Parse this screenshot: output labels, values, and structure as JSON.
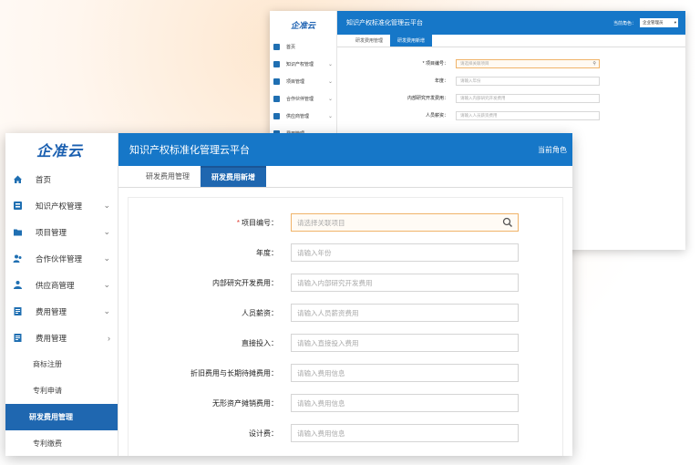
{
  "back_window": {
    "logo": "企准云",
    "title": "知识产权标准化管理云平台",
    "role_label": "当前角色：",
    "role_value": "企业管理员",
    "nav": [
      "首页",
      "知识产权管理",
      "项目管理",
      "合作伙伴管理",
      "供应商管理",
      "费用管理"
    ],
    "tabs": [
      "研发费用管理",
      "研发费用新增"
    ],
    "fields": [
      {
        "label": "* 项目编号：",
        "placeholder": "请选择关联项目"
      },
      {
        "label": "年度：",
        "placeholder": "请输入年份"
      },
      {
        "label": "内部研究开发费用：",
        "placeholder": "请输入内部研究开发费用"
      },
      {
        "label": "人员薪资：",
        "placeholder": "请输入人员薪资费用"
      }
    ]
  },
  "front_window": {
    "logo": "企准云",
    "title": "知识产权标准化管理云平台",
    "role_label": "当前角色",
    "sidebar": {
      "items": [
        {
          "label": "首页",
          "chevron": ""
        },
        {
          "label": "知识产权管理",
          "chevron": "⌄"
        },
        {
          "label": "项目管理",
          "chevron": "⌄"
        },
        {
          "label": "合作伙伴管理",
          "chevron": "⌄"
        },
        {
          "label": "供应商管理",
          "chevron": "⌄"
        },
        {
          "label": "费用管理",
          "chevron": "⌄"
        },
        {
          "label": "费用管理",
          "chevron": "›"
        }
      ],
      "sub_items": [
        "商标注册",
        "专利申请",
        "研发费用管理",
        "专利缴费"
      ]
    },
    "tabs": [
      "研发费用管理",
      "研发费用新增"
    ],
    "form": {
      "fields": [
        {
          "label": "项目编号：",
          "placeholder": "请选择关联项目",
          "required": "*"
        },
        {
          "label": "年度：",
          "placeholder": "请输入年份"
        },
        {
          "label": "内部研究开发费用：",
          "placeholder": "请输入内部研究开发费用"
        },
        {
          "label": "人员薪资：",
          "placeholder": "请输入人员薪资费用"
        },
        {
          "label": "直接投入：",
          "placeholder": "请输入直接投入费用"
        },
        {
          "label": "折旧费用与长期待摊费用：",
          "placeholder": "请输入费用信息"
        },
        {
          "label": "无形资产摊销费用：",
          "placeholder": "请输入费用信息"
        },
        {
          "label": "设计费：",
          "placeholder": "请输入费用信息"
        }
      ]
    }
  },
  "colors": {
    "header_blue": "#1677c8",
    "active_blue": "#1f67b0",
    "highlight_border": "#f0b46a",
    "required_red": "#e03c31"
  }
}
